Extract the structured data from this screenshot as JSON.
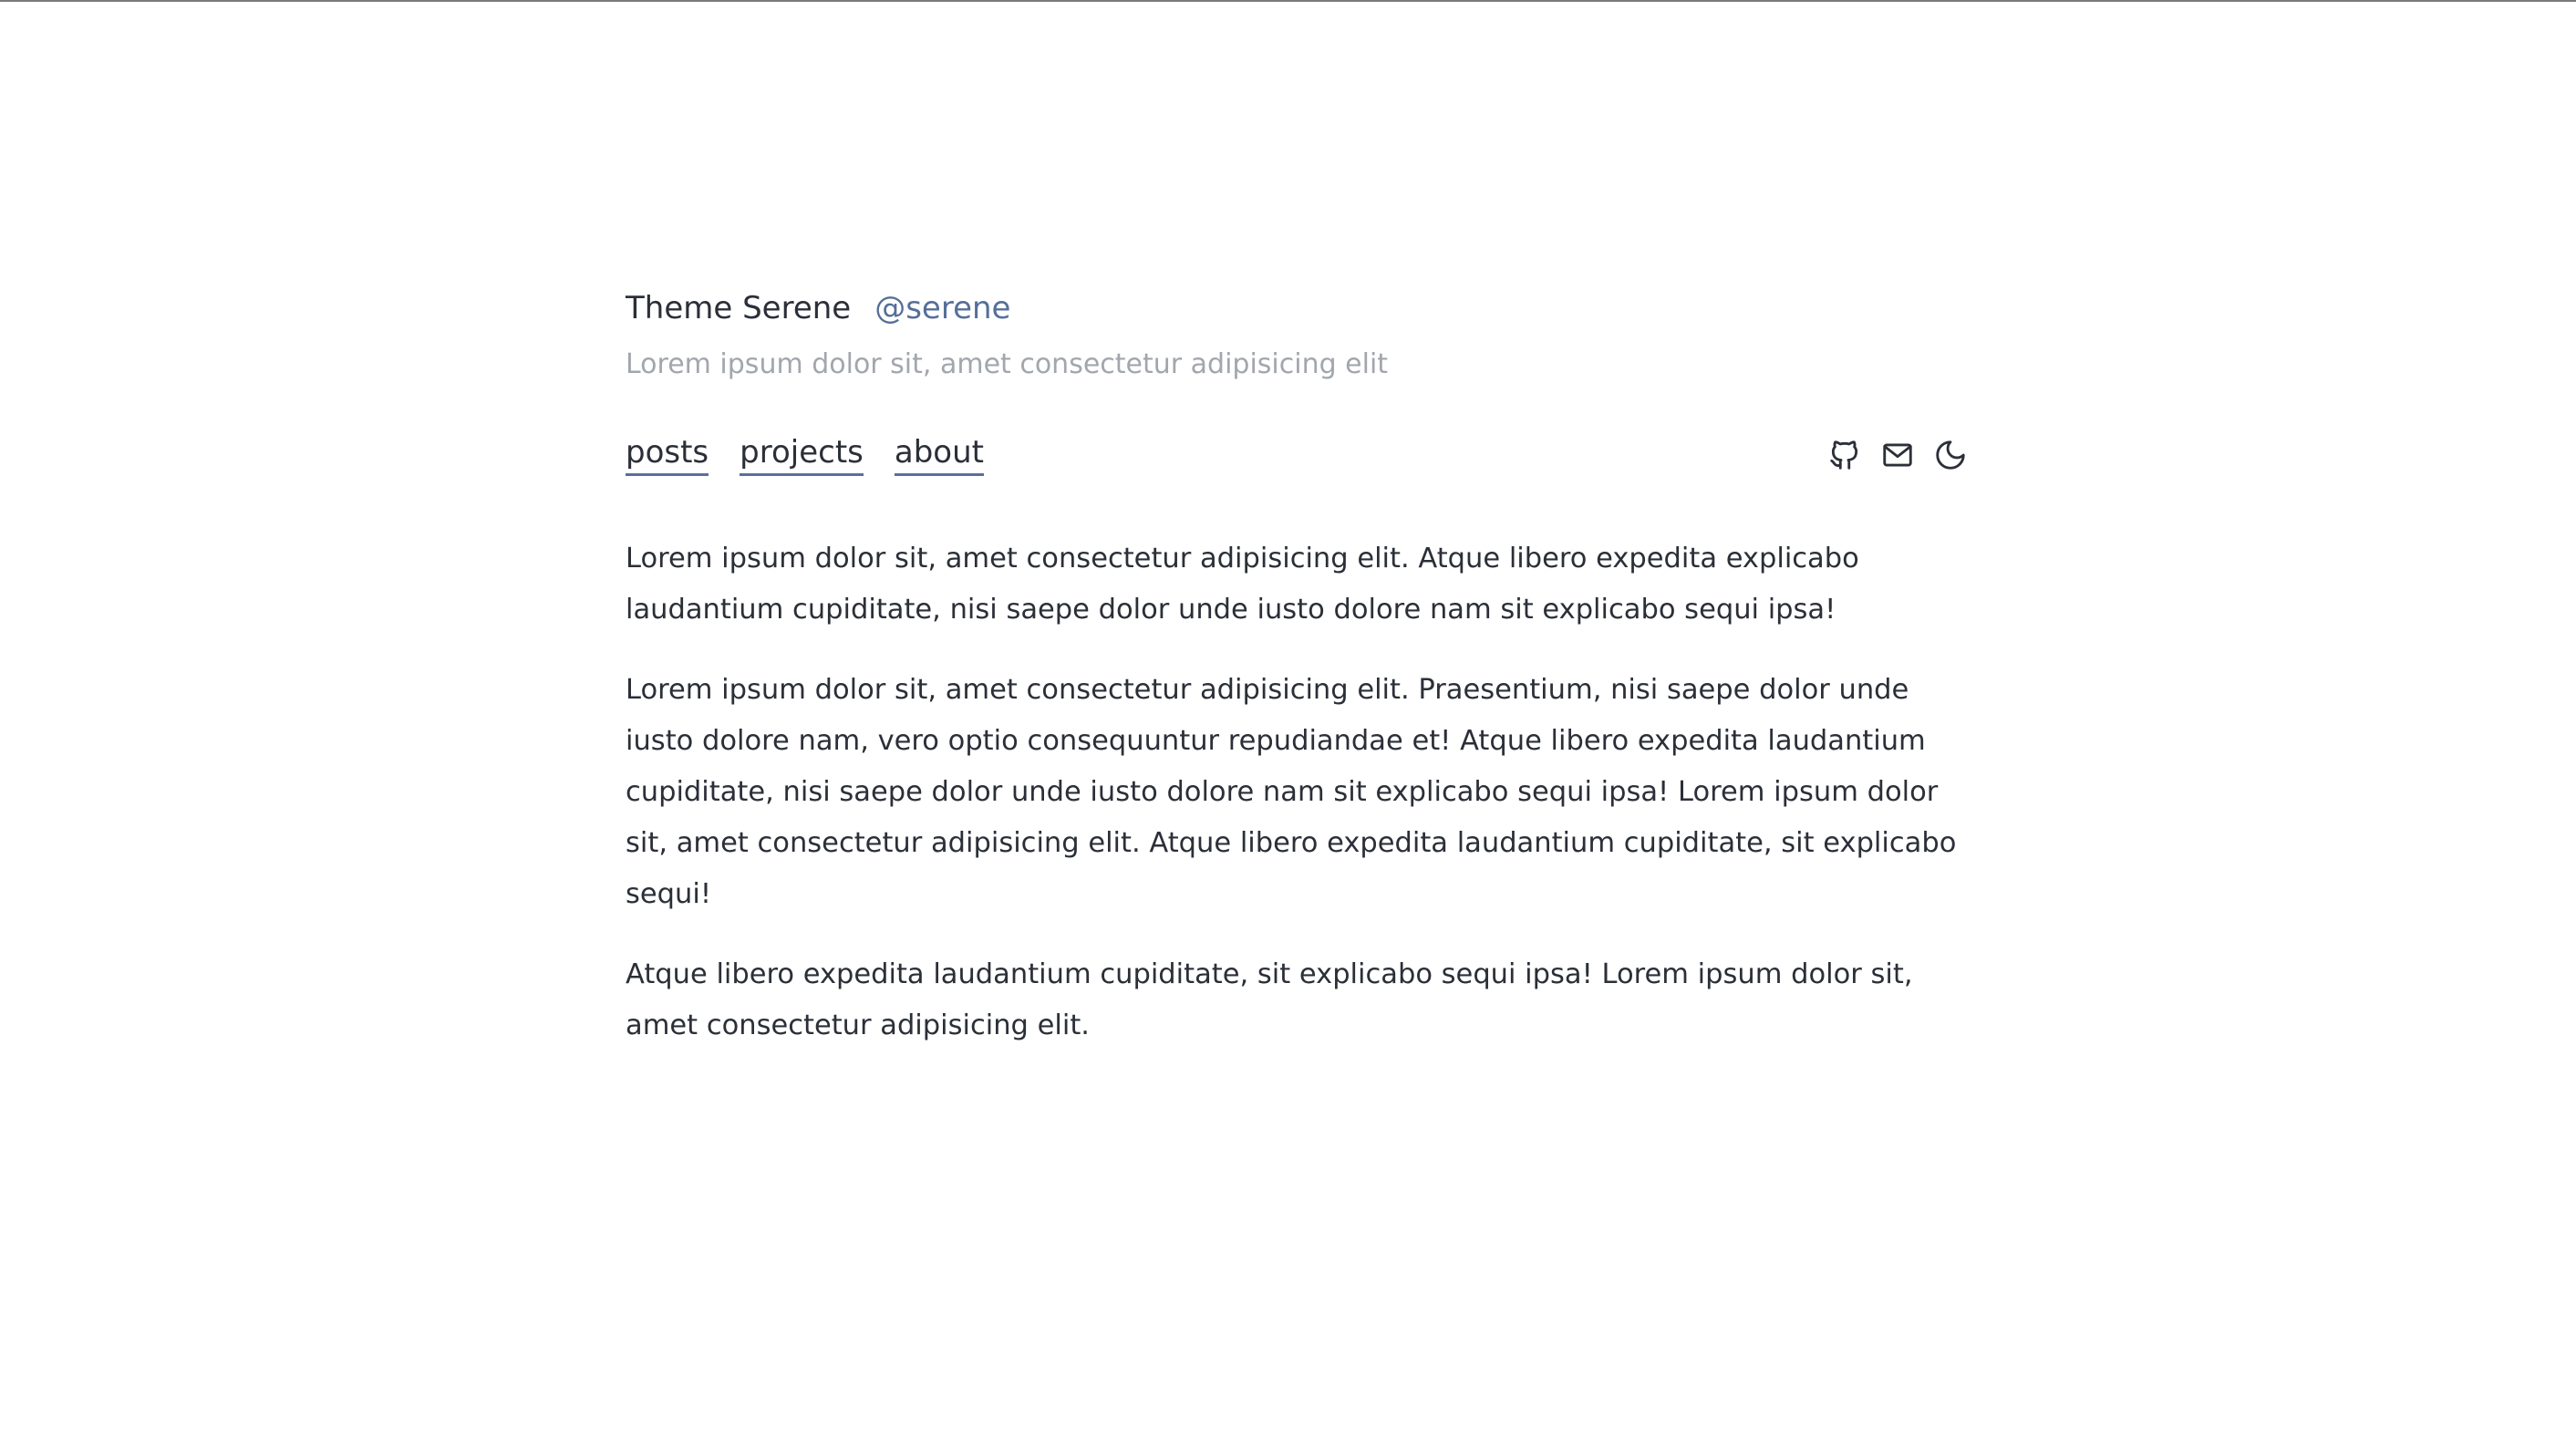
{
  "header": {
    "title": "Theme Serene",
    "handle": "@serene",
    "subtitle": "Lorem ipsum dolor sit, amet consectetur adipisicing elit"
  },
  "nav": {
    "links": [
      {
        "label": "posts"
      },
      {
        "label": "projects"
      },
      {
        "label": "about"
      }
    ],
    "icons": [
      {
        "name": "github-icon"
      },
      {
        "name": "mail-icon"
      },
      {
        "name": "moon-icon"
      }
    ]
  },
  "content": {
    "paragraphs": [
      "Lorem ipsum dolor sit, amet consectetur adipisicing elit. Atque libero expedita explicabo laudantium cupiditate, nisi saepe dolor unde iusto dolore nam sit explicabo sequi ipsa!",
      "Lorem ipsum dolor sit, amet consectetur adipisicing elit. Praesentium, nisi saepe dolor unde iusto dolore nam, vero optio consequuntur repudiandae et! Atque libero expedita laudantium cupiditate, nisi saepe dolor unde iusto dolore nam sit explicabo sequi ipsa! Lorem ipsum dolor sit, amet consectetur adipisicing elit. Atque libero expedita laudantium cupiditate, sit explicabo sequi!",
      "Atque libero expedita laudantium cupiditate, sit explicabo sequi ipsa! Lorem ipsum dolor sit, amet consectetur adipisicing elit."
    ]
  },
  "colors": {
    "text": "#2b2f38",
    "accent": "#566f9a",
    "muted": "#a2a6ad"
  }
}
